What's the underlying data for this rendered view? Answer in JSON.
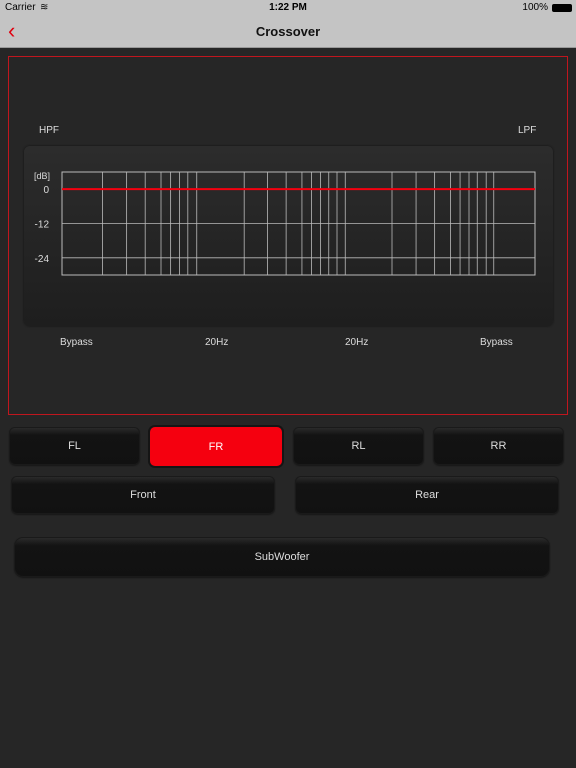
{
  "status": {
    "carrier": "Carrier",
    "time": "1:22 PM",
    "battery": "100%"
  },
  "nav": {
    "title": "Crossover",
    "back_icon": "chevron-left-icon"
  },
  "colors": {
    "accent": "#f5000f"
  },
  "graph": {
    "hpf_label": "HPF",
    "lpf_label": "LPF",
    "unit": "[dB]",
    "y_ticks": [
      "0",
      "-12",
      "-24"
    ],
    "bottom_labels": [
      "Bypass",
      "20Hz",
      "20Hz",
      "Bypass"
    ]
  },
  "chart_data": {
    "type": "line",
    "ylabel": "[dB]",
    "ylim": [
      -30,
      6
    ],
    "y_ticks": [
      0,
      -12,
      -24
    ],
    "grid": true,
    "series": [
      {
        "values": [
          0,
          0
        ]
      }
    ]
  },
  "channels": [
    {
      "label": "FL",
      "active": false
    },
    {
      "label": "FR",
      "active": true
    },
    {
      "label": "RL",
      "active": false
    },
    {
      "label": "RR",
      "active": false
    }
  ],
  "groups": {
    "front": "Front",
    "rear": "Rear",
    "sub": "SubWoofer"
  }
}
